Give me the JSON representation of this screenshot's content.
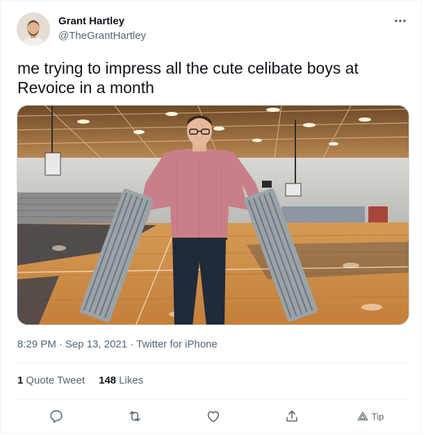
{
  "author": {
    "name": "Grant Hartley",
    "handle": "@TheGrantHartley"
  },
  "tweet": {
    "text": "me trying to impress all the cute celibate boys at Revoice in a month"
  },
  "meta": {
    "time": "8:29 PM",
    "date": "Sep 13, 2021",
    "source": "Twitter for iPhone",
    "separator": "·"
  },
  "stats": {
    "quote_count": "1",
    "quote_label": "Quote Tweet",
    "like_count": "148",
    "like_label": "Likes"
  },
  "actions": {
    "tip_label": "Tip"
  },
  "icons": {
    "more": "more-icon",
    "reply": "reply-icon",
    "retweet": "retweet-icon",
    "like": "heart-icon",
    "share": "share-icon",
    "tip": "tip-icon"
  },
  "colors": {
    "text": "#0f1419",
    "secondary": "#536471",
    "border": "#cfd9de"
  }
}
